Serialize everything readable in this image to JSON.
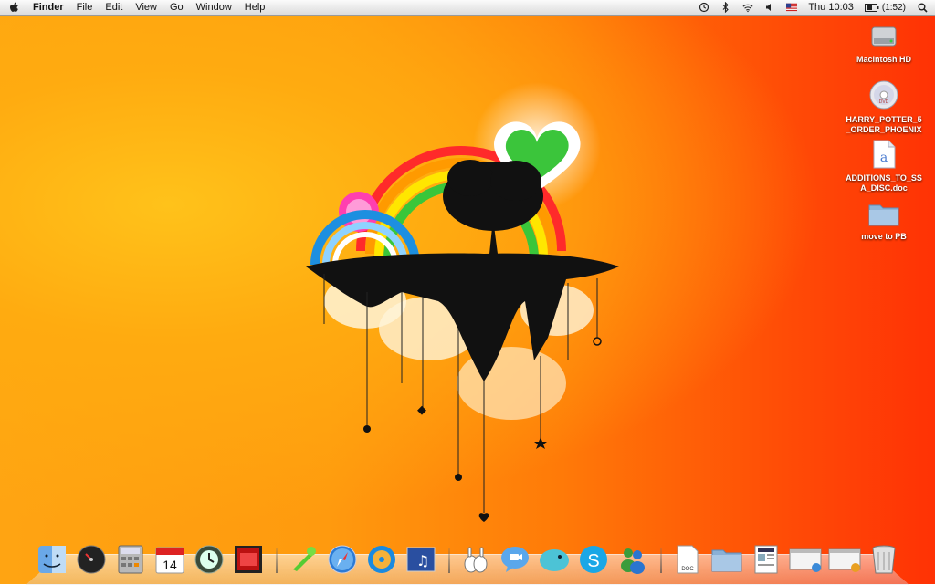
{
  "menubar": {
    "apple_icon": "apple-icon",
    "app_name": "Finder",
    "menus": [
      "File",
      "Edit",
      "View",
      "Go",
      "Window",
      "Help"
    ],
    "status": {
      "time_machine_icon": "time-machine-icon",
      "bluetooth_icon": "bluetooth-icon",
      "wifi_icon": "wifi-icon",
      "volume_icon": "volume-icon",
      "flag_icon": "us-flag-icon",
      "clock": "Thu 10:03",
      "battery_icon": "battery-icon",
      "battery_text": "(1:52)",
      "spotlight_icon": "spotlight-icon"
    }
  },
  "desktop": {
    "items": [
      {
        "label": "Macintosh HD",
        "icon": "hard-drive-icon"
      },
      {
        "label": "HARRY_POTTER_5_ORDER_PHOENIX",
        "icon": "dvd-icon"
      },
      {
        "label": "ADDITIONS_TO_SSA_DISC.doc",
        "icon": "document-icon"
      },
      {
        "label": "move to PB",
        "icon": "folder-icon"
      }
    ]
  },
  "dock": {
    "apps": [
      "finder-icon",
      "dashboard-icon",
      "calculator-icon",
      "ical-icon",
      "time-machine-icon",
      "photo-booth-icon",
      "adium-icon",
      "safari-icon",
      "itunes-icon",
      "garageband-icon",
      "bunny-app-icon",
      "ichat-icon",
      "twitterrific-icon",
      "skype-icon",
      "messenger-icon"
    ],
    "docs": [
      "doc-file-icon",
      "downloads-folder-icon",
      "newspaper-icon",
      "window-preview-icon",
      "window-preview-2-icon",
      "trash-icon"
    ],
    "ical_day": "14",
    "doc_label": "DOC"
  },
  "colors": {
    "wallpaper_left": "#ffa412",
    "wallpaper_right": "#ff3205",
    "menubar": "#f0f0f0"
  }
}
